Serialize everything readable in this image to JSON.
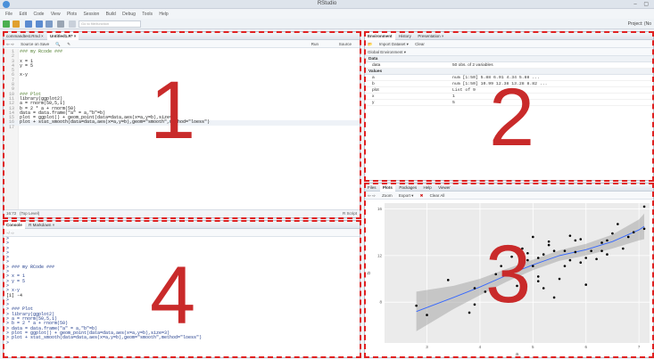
{
  "window": {
    "title": "RStudio",
    "controls": "– ▢"
  },
  "menu": [
    "File",
    "Edit",
    "Code",
    "View",
    "Plots",
    "Session",
    "Build",
    "Debug",
    "Tools",
    "Help"
  ],
  "toolbar": {
    "goto_placeholder": "Go to file/function",
    "project": "Project: (No"
  },
  "editor": {
    "tabs": [
      "commandtest.Rmd ×",
      "Untitled1.R* ×"
    ],
    "toolbar": {
      "source_on_save": "Source on Save",
      "run": "Run",
      "source": "Source"
    },
    "lines": [
      {
        "n": "1",
        "t": "### my Rcode ###"
      },
      {
        "n": "2",
        "t": ""
      },
      {
        "n": "3",
        "t": "x = 1"
      },
      {
        "n": "4",
        "t": "y = 5"
      },
      {
        "n": "5",
        "t": ""
      },
      {
        "n": "6",
        "t": "x-y"
      },
      {
        "n": "7",
        "t": ""
      },
      {
        "n": "8",
        "t": ""
      },
      {
        "n": "9",
        "t": ""
      },
      {
        "n": "10",
        "t": "### Plot"
      },
      {
        "n": "11",
        "t": "library(ggplot2)"
      },
      {
        "n": "12",
        "t": "a = rnorm(50,5,1)"
      },
      {
        "n": "13",
        "t": "b = 2 * a + rnorm(50)"
      },
      {
        "n": "14",
        "t": "data = data.frame(\"a\" = a,\"b\"=b)"
      },
      {
        "n": "15",
        "t": "plot = ggplot() + geom_point(data=data,aes(x=a,y=b),size=3)"
      },
      {
        "n": "16",
        "t": "plot + stat_smooth(data=data,aes(x=a,y=b),geom=\"smooth\",method=\"loess\")"
      },
      {
        "n": "17",
        "t": ""
      }
    ],
    "status": {
      "pos": "16:72",
      "scope": "(Top Level)",
      "type": "R Script"
    }
  },
  "console": {
    "tabs": [
      "Console",
      "R Markdown ×"
    ],
    "path": "~/ ⇨",
    "lines": [
      {
        "t": ">",
        "o": false
      },
      {
        "t": ">",
        "o": false
      },
      {
        "t": ">",
        "o": false
      },
      {
        "t": ">",
        "o": false
      },
      {
        "t": ">",
        "o": false
      },
      {
        "t": ">",
        "o": false
      },
      {
        "t": "> ### my RCode ###",
        "o": false
      },
      {
        "t": ">",
        "o": false
      },
      {
        "t": "> x = 1",
        "o": false
      },
      {
        "t": "> y = 5",
        "o": false
      },
      {
        "t": ">",
        "o": false
      },
      {
        "t": "> x-y",
        "o": false
      },
      {
        "t": "[1] -4",
        "o": true
      },
      {
        "t": ">",
        "o": false
      },
      {
        "t": ">",
        "o": false
      },
      {
        "t": "> ### Plot",
        "o": false
      },
      {
        "t": "> library(ggplot2)",
        "o": false
      },
      {
        "t": "> a = rnorm(50,5,1)",
        "o": false
      },
      {
        "t": "> b = 2 * a + rnorm(50)",
        "o": false
      },
      {
        "t": "> data = data.frame(\"a\" = a,\"b\"=b)",
        "o": false
      },
      {
        "t": "> plot = ggplot() + geom_point(data=data,aes(x=a,y=b),size=3)",
        "o": false
      },
      {
        "t": "> plot + stat_smooth(data=data,aes(x=a,y=b),geom=\"smooth\",method=\"loess\")",
        "o": false
      },
      {
        "t": ">",
        "o": false
      }
    ]
  },
  "environment": {
    "tabs": [
      "Environment",
      "History",
      "Presentation ×"
    ],
    "toolbar": {
      "import": "Import Dataset ▾",
      "clear": "Clear"
    },
    "scope": "Global Environment ▾",
    "data_header": "Data",
    "data_rows": [
      {
        "k": "data",
        "v": "50 obs. of 2 variables"
      }
    ],
    "values_header": "Values",
    "value_rows": [
      {
        "k": "a",
        "v": "num [1:50] 5.88 6.01 4.34 5.88 ..."
      },
      {
        "k": "b",
        "v": "num [1:50] 10.99 12.38 13.28 8.82 ..."
      },
      {
        "k": "plot",
        "v": "List of 9"
      },
      {
        "k": "x",
        "v": "1"
      },
      {
        "k": "y",
        "v": "5"
      }
    ]
  },
  "plots": {
    "tabs": [
      "Files",
      "Plots",
      "Packages",
      "Help",
      "Viewer"
    ],
    "toolbar": {
      "zoom": "Zoom",
      "export": "Export ▾",
      "clear": "Clear All"
    },
    "xlabel": "a",
    "ylabel": "b"
  },
  "overlay_numbers": [
    "1",
    "2",
    "3",
    "4"
  ],
  "chart_data": {
    "type": "scatter",
    "xlabel": "a",
    "ylabel": "b",
    "xlim": [
      2.2,
      7.2
    ],
    "ylim": [
      4.5,
      16.5
    ],
    "x_ticks": [
      "3",
      "4",
      "5",
      "6",
      "7"
    ],
    "y_ticks": [
      "8",
      "12",
      "16"
    ],
    "points": [
      [
        2.8,
        7.7
      ],
      [
        3.0,
        6.9
      ],
      [
        3.4,
        9.9
      ],
      [
        3.9,
        7.8
      ],
      [
        3.9,
        9.2
      ],
      [
        4.1,
        8.9
      ],
      [
        4.3,
        10.4
      ],
      [
        4.4,
        11.1
      ],
      [
        4.7,
        9.4
      ],
      [
        4.8,
        10.1
      ],
      [
        4.8,
        12.6
      ],
      [
        4.9,
        11.6
      ],
      [
        5.0,
        11.1
      ],
      [
        5.0,
        13.6
      ],
      [
        5.1,
        10.2
      ],
      [
        5.1,
        11.8
      ],
      [
        5.2,
        12.1
      ],
      [
        5.2,
        9.2
      ],
      [
        5.3,
        13.2
      ],
      [
        5.3,
        12.9
      ],
      [
        5.4,
        8.4
      ],
      [
        5.4,
        12.4
      ],
      [
        5.5,
        10.0
      ],
      [
        5.6,
        12.4
      ],
      [
        5.7,
        11.6
      ],
      [
        5.7,
        13.7
      ],
      [
        5.8,
        12.3
      ],
      [
        5.9,
        13.4
      ],
      [
        5.9,
        11.4
      ],
      [
        6.0,
        9.5
      ],
      [
        6.0,
        11.8
      ],
      [
        6.1,
        12.4
      ],
      [
        6.2,
        11.7
      ],
      [
        6.3,
        12.4
      ],
      [
        6.3,
        13.1
      ],
      [
        6.4,
        13.3
      ],
      [
        6.5,
        13.9
      ],
      [
        6.6,
        14.7
      ],
      [
        6.7,
        12.6
      ],
      [
        6.8,
        13.6
      ],
      [
        7.1,
        16.2
      ],
      [
        7.1,
        14.3
      ],
      [
        4.6,
        11.9
      ],
      [
        5.1,
        9.8
      ],
      [
        5.8,
        13.3
      ],
      [
        6.9,
        14.0
      ],
      [
        3.8,
        7.1
      ],
      [
        6.4,
        12.1
      ],
      [
        5.6,
        11.1
      ],
      [
        4.9,
        12.2
      ]
    ],
    "smooth": [
      [
        2.8,
        7.2
      ],
      [
        3.5,
        8.4
      ],
      [
        4.0,
        9.3
      ],
      [
        4.5,
        10.3
      ],
      [
        5.0,
        11.2
      ],
      [
        5.5,
        12.0
      ],
      [
        6.0,
        12.5
      ],
      [
        6.5,
        13.2
      ],
      [
        7.0,
        14.2
      ],
      [
        7.1,
        14.5
      ]
    ],
    "band_halfwidth": [
      1.7,
      1.0,
      0.7,
      0.55,
      0.45,
      0.45,
      0.5,
      0.6,
      0.9,
      1.1
    ],
    "colors": {
      "panel": "#ebebeb",
      "grid": "#ffffff",
      "point": "#000000",
      "line": "#3366ff",
      "band": "#999999"
    }
  }
}
